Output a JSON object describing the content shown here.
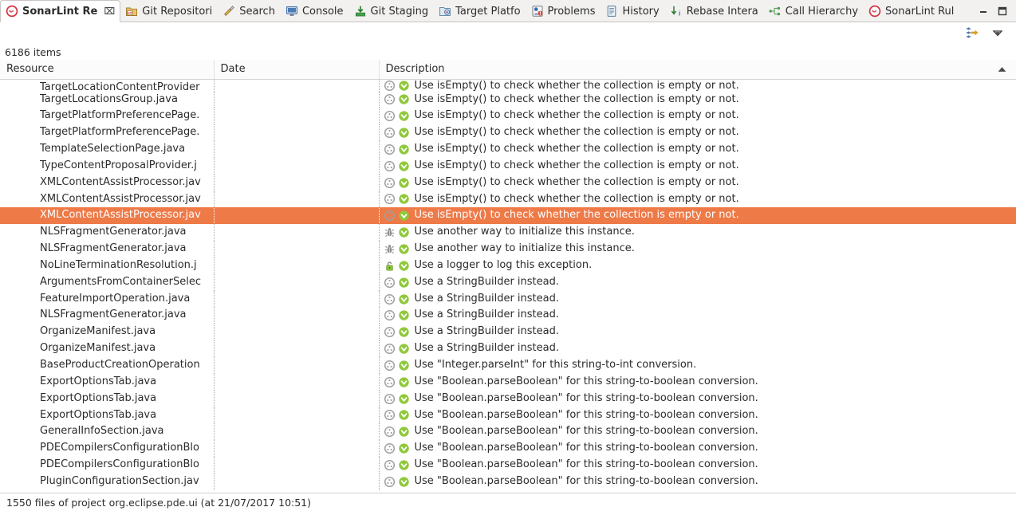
{
  "window": {
    "minimize_label": "Minimize",
    "maximize_label": "Maximize"
  },
  "tabs": [
    {
      "label": "SonarLint Re",
      "icon": "sonarlint-icon",
      "active": true,
      "closable": true,
      "close_glyph": "⌧"
    },
    {
      "label": "Git Repositori",
      "icon": "git-repositories-icon",
      "active": false,
      "closable": false
    },
    {
      "label": "Search",
      "icon": "search-icon",
      "active": false,
      "closable": false
    },
    {
      "label": "Console",
      "icon": "console-icon",
      "active": false,
      "closable": false
    },
    {
      "label": "Git Staging",
      "icon": "git-staging-icon",
      "active": false,
      "closable": false
    },
    {
      "label": "Target Platfo",
      "icon": "target-platform-icon",
      "active": false,
      "closable": false
    },
    {
      "label": "Problems",
      "icon": "problems-icon",
      "active": false,
      "closable": false
    },
    {
      "label": "History",
      "icon": "history-icon",
      "active": false,
      "closable": false
    },
    {
      "label": "Rebase Intera",
      "icon": "rebase-interactive-icon",
      "active": false,
      "closable": false
    },
    {
      "label": "Call Hierarchy",
      "icon": "call-hierarchy-icon",
      "active": false,
      "closable": false
    },
    {
      "label": "SonarLint Rul",
      "icon": "sonarlint-rules-icon",
      "active": false,
      "closable": false
    }
  ],
  "toolbar": {
    "buttons": [
      {
        "name": "link-with-editor-button",
        "icon": "link-with-editor-icon"
      },
      {
        "name": "view-menu-button",
        "icon": "chevron-down-icon"
      }
    ]
  },
  "item_count": "6186 items",
  "table": {
    "columns": [
      {
        "key": "resource",
        "label": "Resource",
        "sorted": false
      },
      {
        "key": "date",
        "label": "Date",
        "sorted": false
      },
      {
        "key": "description",
        "label": "Description",
        "sorted": true,
        "sort_direction": "asc"
      }
    ],
    "rows": [
      {
        "resource": "TargetLocationContentProvider",
        "date": "",
        "type_icon": "code-smell-icon",
        "severity_icon": "severity-minor-icon",
        "description": "Use isEmpty() to check whether the collection is empty or not.",
        "selected": false,
        "clipped": true
      },
      {
        "resource": "TargetLocationsGroup.java",
        "date": "",
        "type_icon": "code-smell-icon",
        "severity_icon": "severity-minor-icon",
        "description": "Use isEmpty() to check whether the collection is empty or not.",
        "selected": false
      },
      {
        "resource": "TargetPlatformPreferencePage.",
        "date": "",
        "type_icon": "code-smell-icon",
        "severity_icon": "severity-minor-icon",
        "description": "Use isEmpty() to check whether the collection is empty or not.",
        "selected": false
      },
      {
        "resource": "TargetPlatformPreferencePage.",
        "date": "",
        "type_icon": "code-smell-icon",
        "severity_icon": "severity-minor-icon",
        "description": "Use isEmpty() to check whether the collection is empty or not.",
        "selected": false
      },
      {
        "resource": "TemplateSelectionPage.java",
        "date": "",
        "type_icon": "code-smell-icon",
        "severity_icon": "severity-minor-icon",
        "description": "Use isEmpty() to check whether the collection is empty or not.",
        "selected": false
      },
      {
        "resource": "TypeContentProposalProvider.j",
        "date": "",
        "type_icon": "code-smell-icon",
        "severity_icon": "severity-minor-icon",
        "description": "Use isEmpty() to check whether the collection is empty or not.",
        "selected": false
      },
      {
        "resource": "XMLContentAssistProcessor.jav",
        "date": "",
        "type_icon": "code-smell-icon",
        "severity_icon": "severity-minor-icon",
        "description": "Use isEmpty() to check whether the collection is empty or not.",
        "selected": false
      },
      {
        "resource": "XMLContentAssistProcessor.jav",
        "date": "",
        "type_icon": "code-smell-icon",
        "severity_icon": "severity-minor-icon",
        "description": "Use isEmpty() to check whether the collection is empty or not.",
        "selected": false
      },
      {
        "resource": "XMLContentAssistProcessor.jav",
        "date": "",
        "type_icon": "code-smell-icon",
        "severity_icon": "severity-minor-icon",
        "description": "Use isEmpty() to check whether the collection is empty or not.",
        "selected": true
      },
      {
        "resource": "NLSFragmentGenerator.java",
        "date": "",
        "type_icon": "bug-icon",
        "severity_icon": "severity-minor-icon",
        "description": "Use another way to initialize this instance.",
        "selected": false
      },
      {
        "resource": "NLSFragmentGenerator.java",
        "date": "",
        "type_icon": "bug-icon",
        "severity_icon": "severity-minor-icon",
        "description": "Use another way to initialize this instance.",
        "selected": false
      },
      {
        "resource": "NoLineTerminationResolution.j",
        "date": "",
        "type_icon": "vulnerability-icon",
        "severity_icon": "severity-minor-icon",
        "description": "Use a logger to log this exception.",
        "selected": false
      },
      {
        "resource": "ArgumentsFromContainerSelec",
        "date": "",
        "type_icon": "code-smell-icon",
        "severity_icon": "severity-minor-icon",
        "description": "Use a StringBuilder instead.",
        "selected": false
      },
      {
        "resource": "FeatureImportOperation.java",
        "date": "",
        "type_icon": "code-smell-icon",
        "severity_icon": "severity-minor-icon",
        "description": "Use a StringBuilder instead.",
        "selected": false
      },
      {
        "resource": "NLSFragmentGenerator.java",
        "date": "",
        "type_icon": "code-smell-icon",
        "severity_icon": "severity-minor-icon",
        "description": "Use a StringBuilder instead.",
        "selected": false
      },
      {
        "resource": "OrganizeManifest.java",
        "date": "",
        "type_icon": "code-smell-icon",
        "severity_icon": "severity-minor-icon",
        "description": "Use a StringBuilder instead.",
        "selected": false
      },
      {
        "resource": "OrganizeManifest.java",
        "date": "",
        "type_icon": "code-smell-icon",
        "severity_icon": "severity-minor-icon",
        "description": "Use a StringBuilder instead.",
        "selected": false
      },
      {
        "resource": "BaseProductCreationOperation",
        "date": "",
        "type_icon": "code-smell-icon",
        "severity_icon": "severity-minor-icon",
        "description": "Use \"Integer.parseInt\" for this string-to-int conversion.",
        "selected": false
      },
      {
        "resource": "ExportOptionsTab.java",
        "date": "",
        "type_icon": "code-smell-icon",
        "severity_icon": "severity-minor-icon",
        "description": "Use \"Boolean.parseBoolean\" for this string-to-boolean conversion.",
        "selected": false
      },
      {
        "resource": "ExportOptionsTab.java",
        "date": "",
        "type_icon": "code-smell-icon",
        "severity_icon": "severity-minor-icon",
        "description": "Use \"Boolean.parseBoolean\" for this string-to-boolean conversion.",
        "selected": false
      },
      {
        "resource": "ExportOptionsTab.java",
        "date": "",
        "type_icon": "code-smell-icon",
        "severity_icon": "severity-minor-icon",
        "description": "Use \"Boolean.parseBoolean\" for this string-to-boolean conversion.",
        "selected": false
      },
      {
        "resource": "GeneralInfoSection.java",
        "date": "",
        "type_icon": "code-smell-icon",
        "severity_icon": "severity-minor-icon",
        "description": "Use \"Boolean.parseBoolean\" for this string-to-boolean conversion.",
        "selected": false
      },
      {
        "resource": "PDECompilersConfigurationBlo",
        "date": "",
        "type_icon": "code-smell-icon",
        "severity_icon": "severity-minor-icon",
        "description": "Use \"Boolean.parseBoolean\" for this string-to-boolean conversion.",
        "selected": false
      },
      {
        "resource": "PDECompilersConfigurationBlo",
        "date": "",
        "type_icon": "code-smell-icon",
        "severity_icon": "severity-minor-icon",
        "description": "Use \"Boolean.parseBoolean\" for this string-to-boolean conversion.",
        "selected": false
      },
      {
        "resource": "PluginConfigurationSection.jav",
        "date": "",
        "type_icon": "code-smell-icon",
        "severity_icon": "severity-minor-icon",
        "description": "Use \"Boolean.parseBoolean\" for this string-to-boolean conversion.",
        "selected": false
      }
    ]
  },
  "statusbar": {
    "text": "1550 files of project org.eclipse.pde.ui (at 21/07/2017 10:51)"
  },
  "colors": {
    "selection": "#ee7a48",
    "sonarlint_red": "#d4333f",
    "severity_green": "#8fc93a",
    "code_smell_gray": "#a0a0a0",
    "header_bg": "#fbfbfb",
    "tabbar_bg": "#f2f1f0"
  }
}
